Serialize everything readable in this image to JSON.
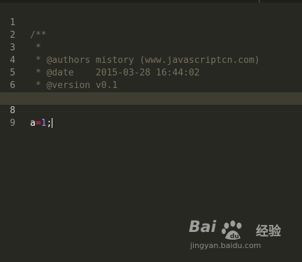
{
  "editor": {
    "theme_colors": {
      "background": "#272822",
      "comment": "#75715e",
      "operator": "#f92672",
      "number": "#ae81ff",
      "text": "#f8f8f2",
      "current_line": "#3e3d32"
    },
    "lines": [
      {
        "number": "1",
        "text": "/**"
      },
      {
        "number": "2",
        "text": " *"
      },
      {
        "number": "3",
        "text": " * @authors mistory (www.javascriptcn.com)"
      },
      {
        "number": "4",
        "text": " * @date    2015-03-28 16:44:02"
      },
      {
        "number": "5",
        "text": " * @version v0.1"
      },
      {
        "number": "6",
        "text": " */"
      },
      {
        "number": "7",
        "text": ""
      },
      {
        "number": "8",
        "tokens": {
          "var": "a",
          "op": "=",
          "num": "1",
          "punct": ";"
        }
      },
      {
        "number": "9",
        "text": ""
      }
    ],
    "current_line": "8"
  },
  "watermark": {
    "brand": "Bai",
    "brand2": "经验",
    "url": "jingyan.baidu.com",
    "icon": "paw-icon"
  }
}
